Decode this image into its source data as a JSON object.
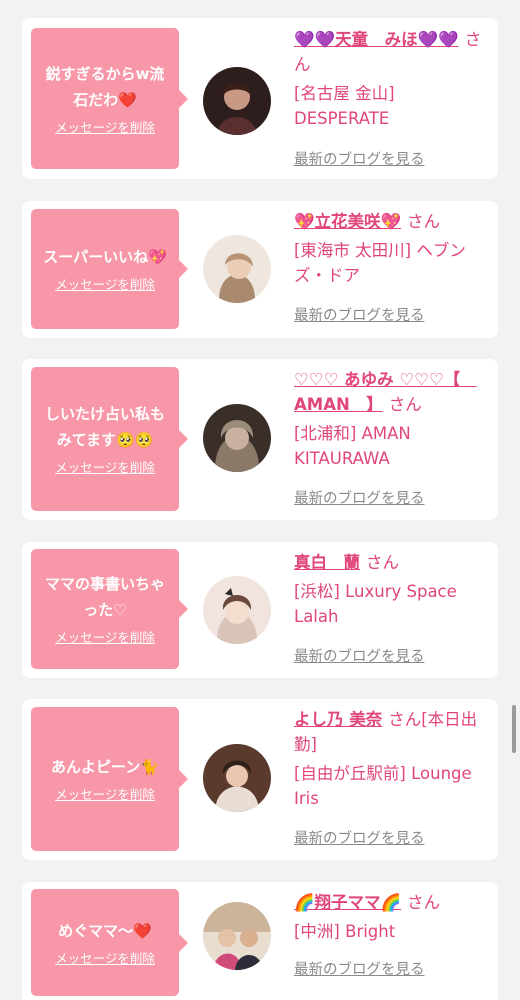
{
  "entries": [
    {
      "message": "鋭すぎるからw流石だわ❤️",
      "delete_label": "メッセージを削除",
      "name": "💜💜天童　みほ💜💜",
      "honorific": "さん",
      "shop": "[名古屋 金山] DESPERATE",
      "blog_label": "最新のブログを見る",
      "avatar_color": "#3a2626"
    },
    {
      "message": "スーパーいいね💖",
      "delete_label": "メッセージを削除",
      "name": "💖立花美咲💖",
      "honorific": "さん",
      "shop": "[東海市 太田川] ヘブンズ・ドア",
      "blog_label": "最新のブログを見る",
      "avatar_color": "#d7c6b6"
    },
    {
      "message": "しいたけ占い私もみてます🥺🥺",
      "delete_label": "メッセージを削除",
      "name": "♡♡♡ あゆみ ♡♡♡【　AMAN　】",
      "honorific": "さん",
      "shop": "[北浦和] AMAN KITAURAWA",
      "blog_label": "最新のブログを見る",
      "avatar_color": "#4a3b33"
    },
    {
      "message": "ママの事書いちゃった♡",
      "delete_label": "メッセージを削除",
      "name": "真白　蘭",
      "honorific": "さん",
      "shop": "[浜松] Luxury Space Lalah",
      "blog_label": "最新のブログを見る",
      "avatar_color": "#e8d8d2"
    },
    {
      "message": "あんよピーン🐈",
      "delete_label": "メッセージを削除",
      "name": "よし乃 美奈",
      "honorific": "さん[本日出勤]",
      "shop": "[自由が丘駅前] Lounge Iris",
      "blog_label": "最新のブログを見る",
      "avatar_color": "#6b4a3a"
    },
    {
      "message": "めぐママ〜❤️",
      "delete_label": "メッセージを削除",
      "name": "🌈翔子ママ🌈",
      "honorific": "さん",
      "shop": "[中洲] Bright",
      "blog_label": "最新のブログを見る",
      "avatar_color": "#c9a887"
    }
  ]
}
